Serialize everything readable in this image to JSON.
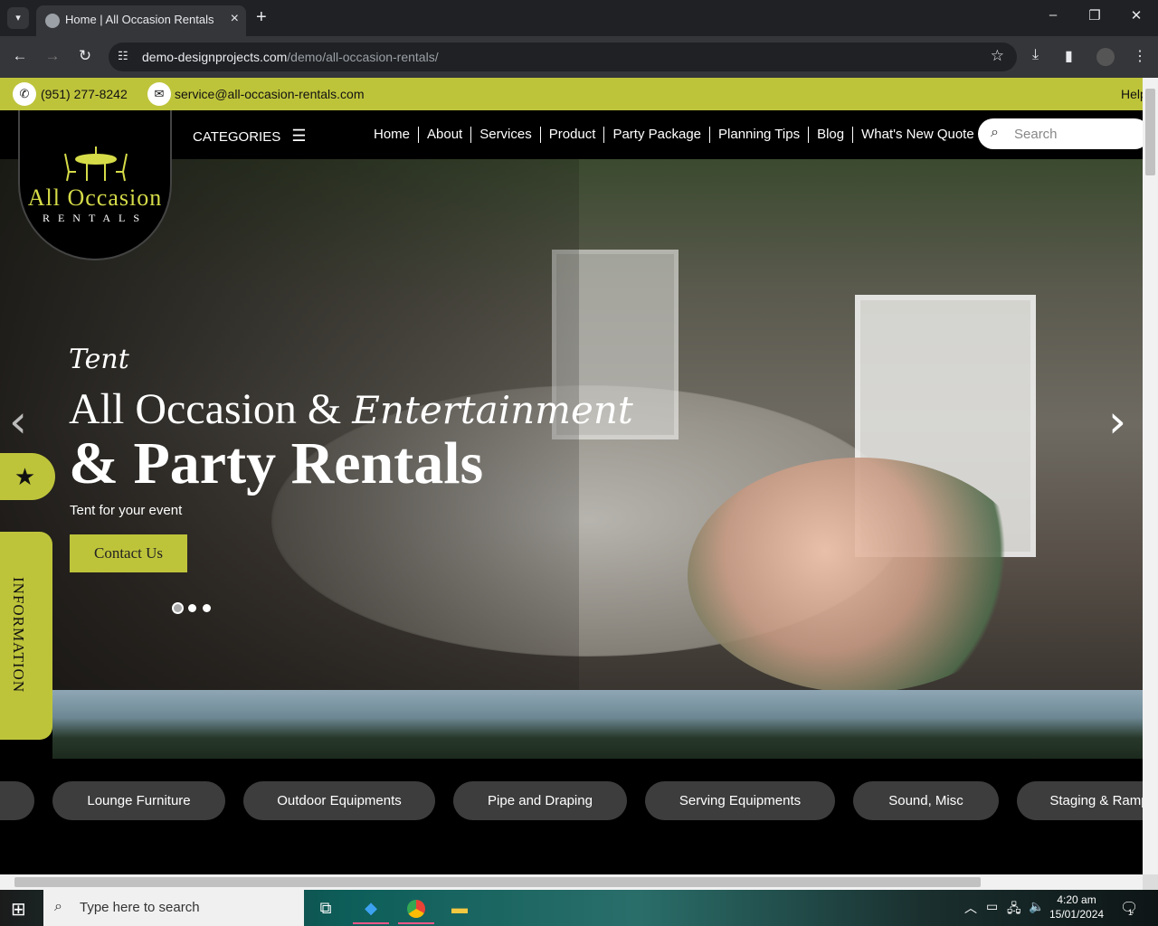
{
  "browser": {
    "tab_title": "Home | All Occasion Rentals",
    "url_host": "demo-designprojects.com",
    "url_path": "/demo/all-occasion-rentals/"
  },
  "topbar": {
    "phone": "(951) 277-8242",
    "email": "service@all-occasion-rentals.com",
    "help": "Help"
  },
  "logo": {
    "name": "All Occasion",
    "sub": "RENTALS"
  },
  "nav": {
    "categories": "CATEGORIES",
    "items": [
      "Home",
      "About",
      "Services",
      "Product",
      "Party Package",
      "Planning Tips",
      "Blog",
      "What's New Quote"
    ],
    "search_placeholder": "Search"
  },
  "hero": {
    "script_word": "Tent",
    "line1": "All Occasion &",
    "line1_script": "Entertainment",
    "line2": "& Party Rentals",
    "tagline": "Tent for your event",
    "cta": "Contact Us",
    "slide_count": 3,
    "active_slide": 1
  },
  "side_tabs": {
    "info": "INFORMATION"
  },
  "categories": [
    "Lounge Furniture",
    "Outdoor Equipments",
    "Pipe and Draping",
    "Serving Equipments",
    "Sound, Misc",
    "Staging & Ramp"
  ],
  "taskbar": {
    "search_placeholder": "Type here to search",
    "time": "4:20 am",
    "date": "15/01/2024",
    "notifications": "1"
  },
  "colors": {
    "accent": "#bec43a",
    "nav_bg": "#000000",
    "pill": "#3d3d3d"
  }
}
